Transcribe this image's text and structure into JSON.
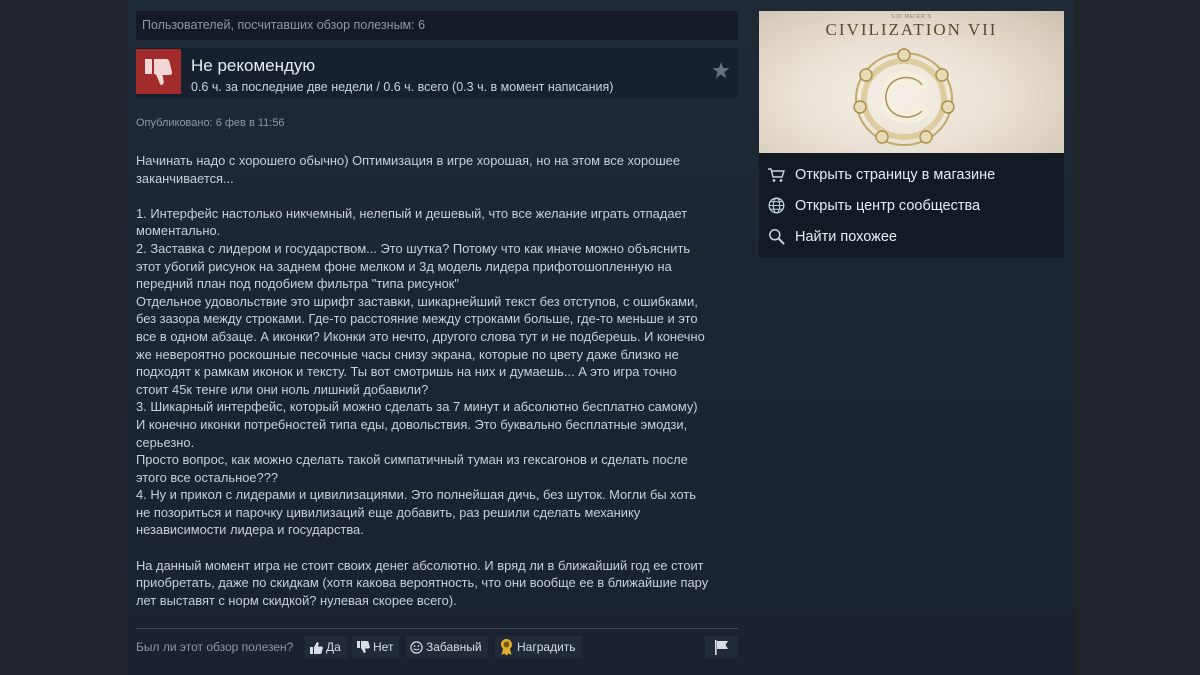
{
  "helpful_count_text": "Пользователей, посчитавших обзор полезным: 6",
  "review": {
    "verdict": "Не рекомендую",
    "hours": "0.6 ч. за последние две недели / 0.6 ч. всего (0.3 ч. в момент написания)",
    "posted": "Опубликовано: 6 фев в 11:56",
    "paragraphs": [
      "Начинать надо с хорошего обычно) Оптимизация в игре хорошая, но на этом все хорошее\nзаканчивается...",
      "1. Интерфейс настолько никчемный, нелепый и дешевый, что все желание играть отпадает\nмоментально.\n2. Заставка с лидером и государством... Это шутка? Потому что как иначе можно объяснить\nэтот убогий рисунок на заднем фоне мелком и 3д модель лидера прифотошопленную на\nпередний план под подобием фильтра \"типа рисунок\"\nОтдельное удовольствие это шрифт заставки, шикарнейший текст без отступов, с ошибками,\nбез зазора между строками. Где-то расстояние между строками больше, где-то меньше и это\nвсе в одном абзаце. А иконки? Иконки это нечто, другого слова тут и не подберешь. И конечно\nже невероятно роскошные песочные часы снизу экрана, которые по цвету даже близко не\nподходят к рамкам иконок и тексту. Ты вот смотришь на них и думаешь... А это игра точно\nстоит 45к тенге или они ноль лишний добавили?\n3. Шикарный интерфейс, который можно сделать за 7 минут и абсолютно бесплатно самому)\nИ конечно иконки потребностей типа еды, довольствия. Это буквально бесплатные эмодзи,\nсерьезно.\nПросто вопрос, как можно сделать такой симпатичный туман из гексагонов и сделать после\nэтого все остальное???\n4. Ну и прикол с лидерами и цивилизациями. Это полнейшая дичь, без шуток. Могли бы хоть\nне позориться и парочку цивилизаций еще добавить, раз решили сделать механику\nнезависимости лидера и государства.",
      "На данный момент игра не стоит своих денег абсолютно. И вряд ли в ближайший год ее стоит\nприобретать, даже по скидкам (хотя какова вероятность, что они вообще ее в ближайшие пару\nлет выставят с норм скидкой? нулевая скорее всего)."
    ]
  },
  "footer": {
    "question": "Был ли этот обзор полезен?",
    "yes": "Да",
    "no": "Нет",
    "funny": "Забавный",
    "award": "Наградить"
  },
  "game": {
    "title": "CIVILIZATION VII",
    "subtitle": "SID MEIER'S",
    "links": [
      {
        "label": "Открыть страницу в магазине",
        "icon": "cart-icon"
      },
      {
        "label": "Открыть центр сообщества",
        "icon": "globe-icon"
      },
      {
        "label": "Найти похожее",
        "icon": "search-icon"
      }
    ]
  },
  "colors": {
    "thumb_down_bg": "#a22b2b",
    "panel_bg": "#1f2a37",
    "text": "#c6d4df"
  }
}
